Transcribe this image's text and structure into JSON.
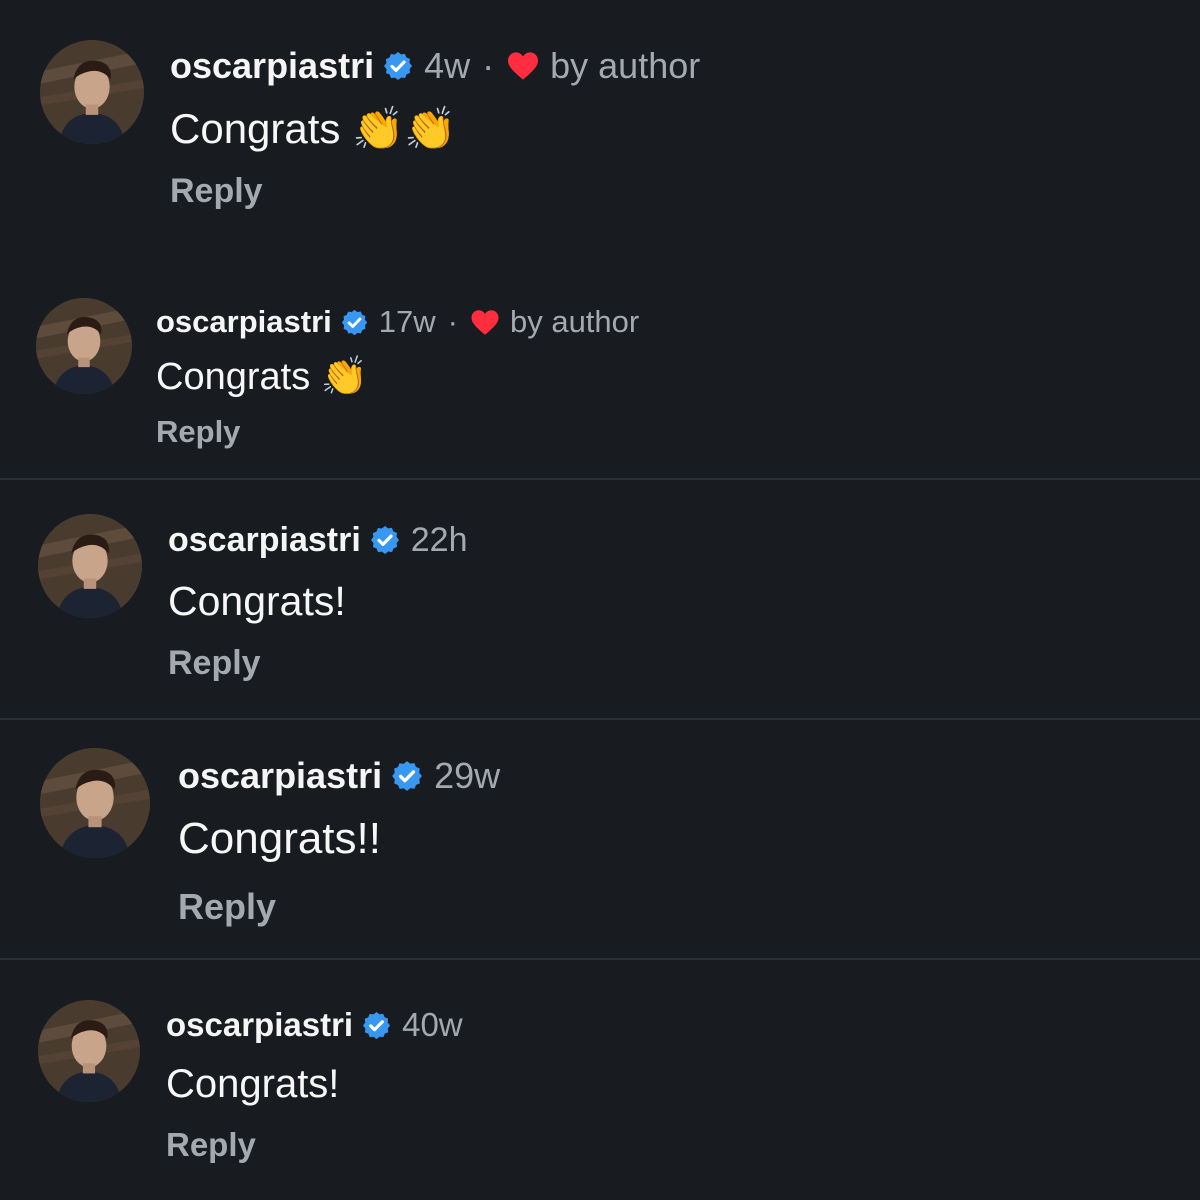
{
  "comments": [
    {
      "username": "oscarpiastri",
      "time": "4w",
      "separator": "·",
      "liked_by_author": true,
      "liked_label": "by author",
      "text": "Congrats 👏👏",
      "reply_label": "Reply"
    },
    {
      "username": "oscarpiastri",
      "time": "17w",
      "separator": "·",
      "liked_by_author": true,
      "liked_label": "by author",
      "text": "Congrats 👏",
      "reply_label": "Reply"
    },
    {
      "username": "oscarpiastri",
      "time": "22h",
      "text": "Congrats!",
      "reply_label": "Reply"
    },
    {
      "username": "oscarpiastri",
      "time": "29w",
      "text": "Congrats!!",
      "reply_label": "Reply"
    },
    {
      "username": "oscarpiastri",
      "time": "40w",
      "text": "Congrats!",
      "reply_label": "Reply"
    }
  ],
  "colors": {
    "background": "#181b20",
    "verified_badge": "#3897f0",
    "heart": "#ff2d3d",
    "secondary_text": "#a4a9b0"
  },
  "icons": {
    "verified": "verified-badge-icon",
    "heart": "heart-icon",
    "avatar": "profile-photo"
  }
}
